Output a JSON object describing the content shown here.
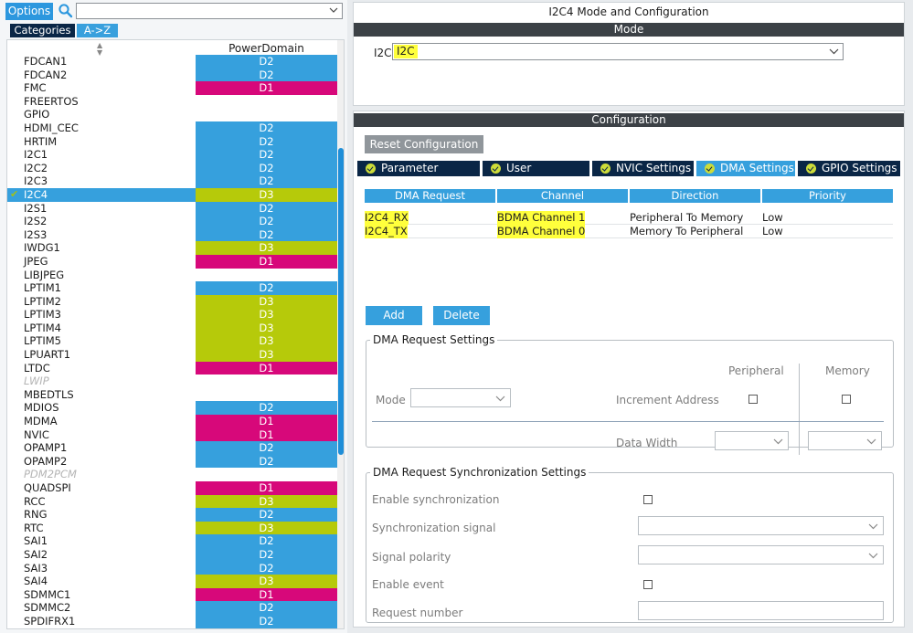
{
  "left": {
    "options_label": "Options",
    "search_value": "",
    "tabs": {
      "categories": "Categories",
      "az": "A->Z"
    },
    "column_header": "PowerDomain",
    "sort_indicator": "▲\n▼",
    "items": [
      {
        "name": "FDCAN1",
        "pd": "D2"
      },
      {
        "name": "FDCAN2",
        "pd": "D2"
      },
      {
        "name": "FMC",
        "pd": "D1"
      },
      {
        "name": "FREERTOS",
        "pd": ""
      },
      {
        "name": "GPIO",
        "pd": ""
      },
      {
        "name": "HDMI_CEC",
        "pd": "D2"
      },
      {
        "name": "HRTIM",
        "pd": "D2"
      },
      {
        "name": "I2C1",
        "pd": "D2"
      },
      {
        "name": "I2C2",
        "pd": "D2"
      },
      {
        "name": "I2C3",
        "pd": "D2"
      },
      {
        "name": "I2C4",
        "pd": "D3",
        "selected": true,
        "checked": true
      },
      {
        "name": "I2S1",
        "pd": "D2"
      },
      {
        "name": "I2S2",
        "pd": "D2"
      },
      {
        "name": "I2S3",
        "pd": "D2"
      },
      {
        "name": "IWDG1",
        "pd": "D3"
      },
      {
        "name": "JPEG",
        "pd": "D1"
      },
      {
        "name": "LIBJPEG",
        "pd": ""
      },
      {
        "name": "LPTIM1",
        "pd": "D2"
      },
      {
        "name": "LPTIM2",
        "pd": "D3"
      },
      {
        "name": "LPTIM3",
        "pd": "D3"
      },
      {
        "name": "LPTIM4",
        "pd": "D3"
      },
      {
        "name": "LPTIM5",
        "pd": "D3"
      },
      {
        "name": "LPUART1",
        "pd": "D3"
      },
      {
        "name": "LTDC",
        "pd": "D1"
      },
      {
        "name": "LWIP",
        "pd": "",
        "disabled": true
      },
      {
        "name": "MBEDTLS",
        "pd": ""
      },
      {
        "name": "MDIOS",
        "pd": "D2"
      },
      {
        "name": "MDMA",
        "pd": "D1"
      },
      {
        "name": "NVIC",
        "pd": "D1"
      },
      {
        "name": "OPAMP1",
        "pd": "D2"
      },
      {
        "name": "OPAMP2",
        "pd": "D2"
      },
      {
        "name": "PDM2PCM",
        "pd": "",
        "disabled": true
      },
      {
        "name": "QUADSPI",
        "pd": "D1"
      },
      {
        "name": "RCC",
        "pd": "D3"
      },
      {
        "name": "RNG",
        "pd": "D2"
      },
      {
        "name": "RTC",
        "pd": "D3"
      },
      {
        "name": "SAI1",
        "pd": "D2"
      },
      {
        "name": "SAI2",
        "pd": "D2"
      },
      {
        "name": "SAI3",
        "pd": "D2"
      },
      {
        "name": "SAI4",
        "pd": "D3"
      },
      {
        "name": "SDMMC1",
        "pd": "D1"
      },
      {
        "name": "SDMMC2",
        "pd": "D2"
      },
      {
        "name": "SPDIFRX1",
        "pd": "D2"
      }
    ]
  },
  "colors": {
    "D1": "#d7087a",
    "D2": "#36a0dd",
    "D3": "#b6ca0a",
    "highlight": "#ffff3c",
    "dark": "#0a2646"
  },
  "mode": {
    "title": "I2C4 Mode and Configuration",
    "section": "Mode",
    "i2c_label": "I2C",
    "i2c_value": "I2C"
  },
  "config": {
    "section": "Configuration",
    "reset_label": "Reset Configuration",
    "tabs": [
      {
        "label": "Parameter Settings",
        "active": false
      },
      {
        "label": "User Constants",
        "active": false
      },
      {
        "label": "NVIC Settings",
        "active": false
      },
      {
        "label": "DMA Settings",
        "active": true
      },
      {
        "label": "GPIO Settings",
        "active": false
      }
    ],
    "dma_columns": [
      "DMA Request",
      "Channel",
      "Direction",
      "Priority"
    ],
    "dma_rows": [
      {
        "request": "I2C4_RX",
        "channel": "BDMA Channel 1",
        "direction": "Peripheral To Memory",
        "priority": "Low"
      },
      {
        "request": "I2C4_TX",
        "channel": "BDMA Channel 0",
        "direction": "Memory To Peripheral",
        "priority": "Low"
      }
    ],
    "add_label": "Add",
    "delete_label": "Delete",
    "request_settings": {
      "legend": "DMA Request Settings",
      "peripheral": "Peripheral",
      "memory": "Memory",
      "mode_label": "Mode",
      "mode_value": "",
      "increment_label": "Increment Address",
      "data_width_label": "Data Width",
      "peripheral_width": "",
      "memory_width": ""
    },
    "sync_settings": {
      "legend": "DMA Request Synchronization Settings",
      "enable_sync": "Enable synchronization",
      "sync_signal": "Synchronization signal",
      "sync_signal_value": "",
      "signal_polarity": "Signal polarity",
      "signal_polarity_value": "",
      "enable_event": "Enable event",
      "request_number": "Request number",
      "request_number_value": ""
    }
  }
}
